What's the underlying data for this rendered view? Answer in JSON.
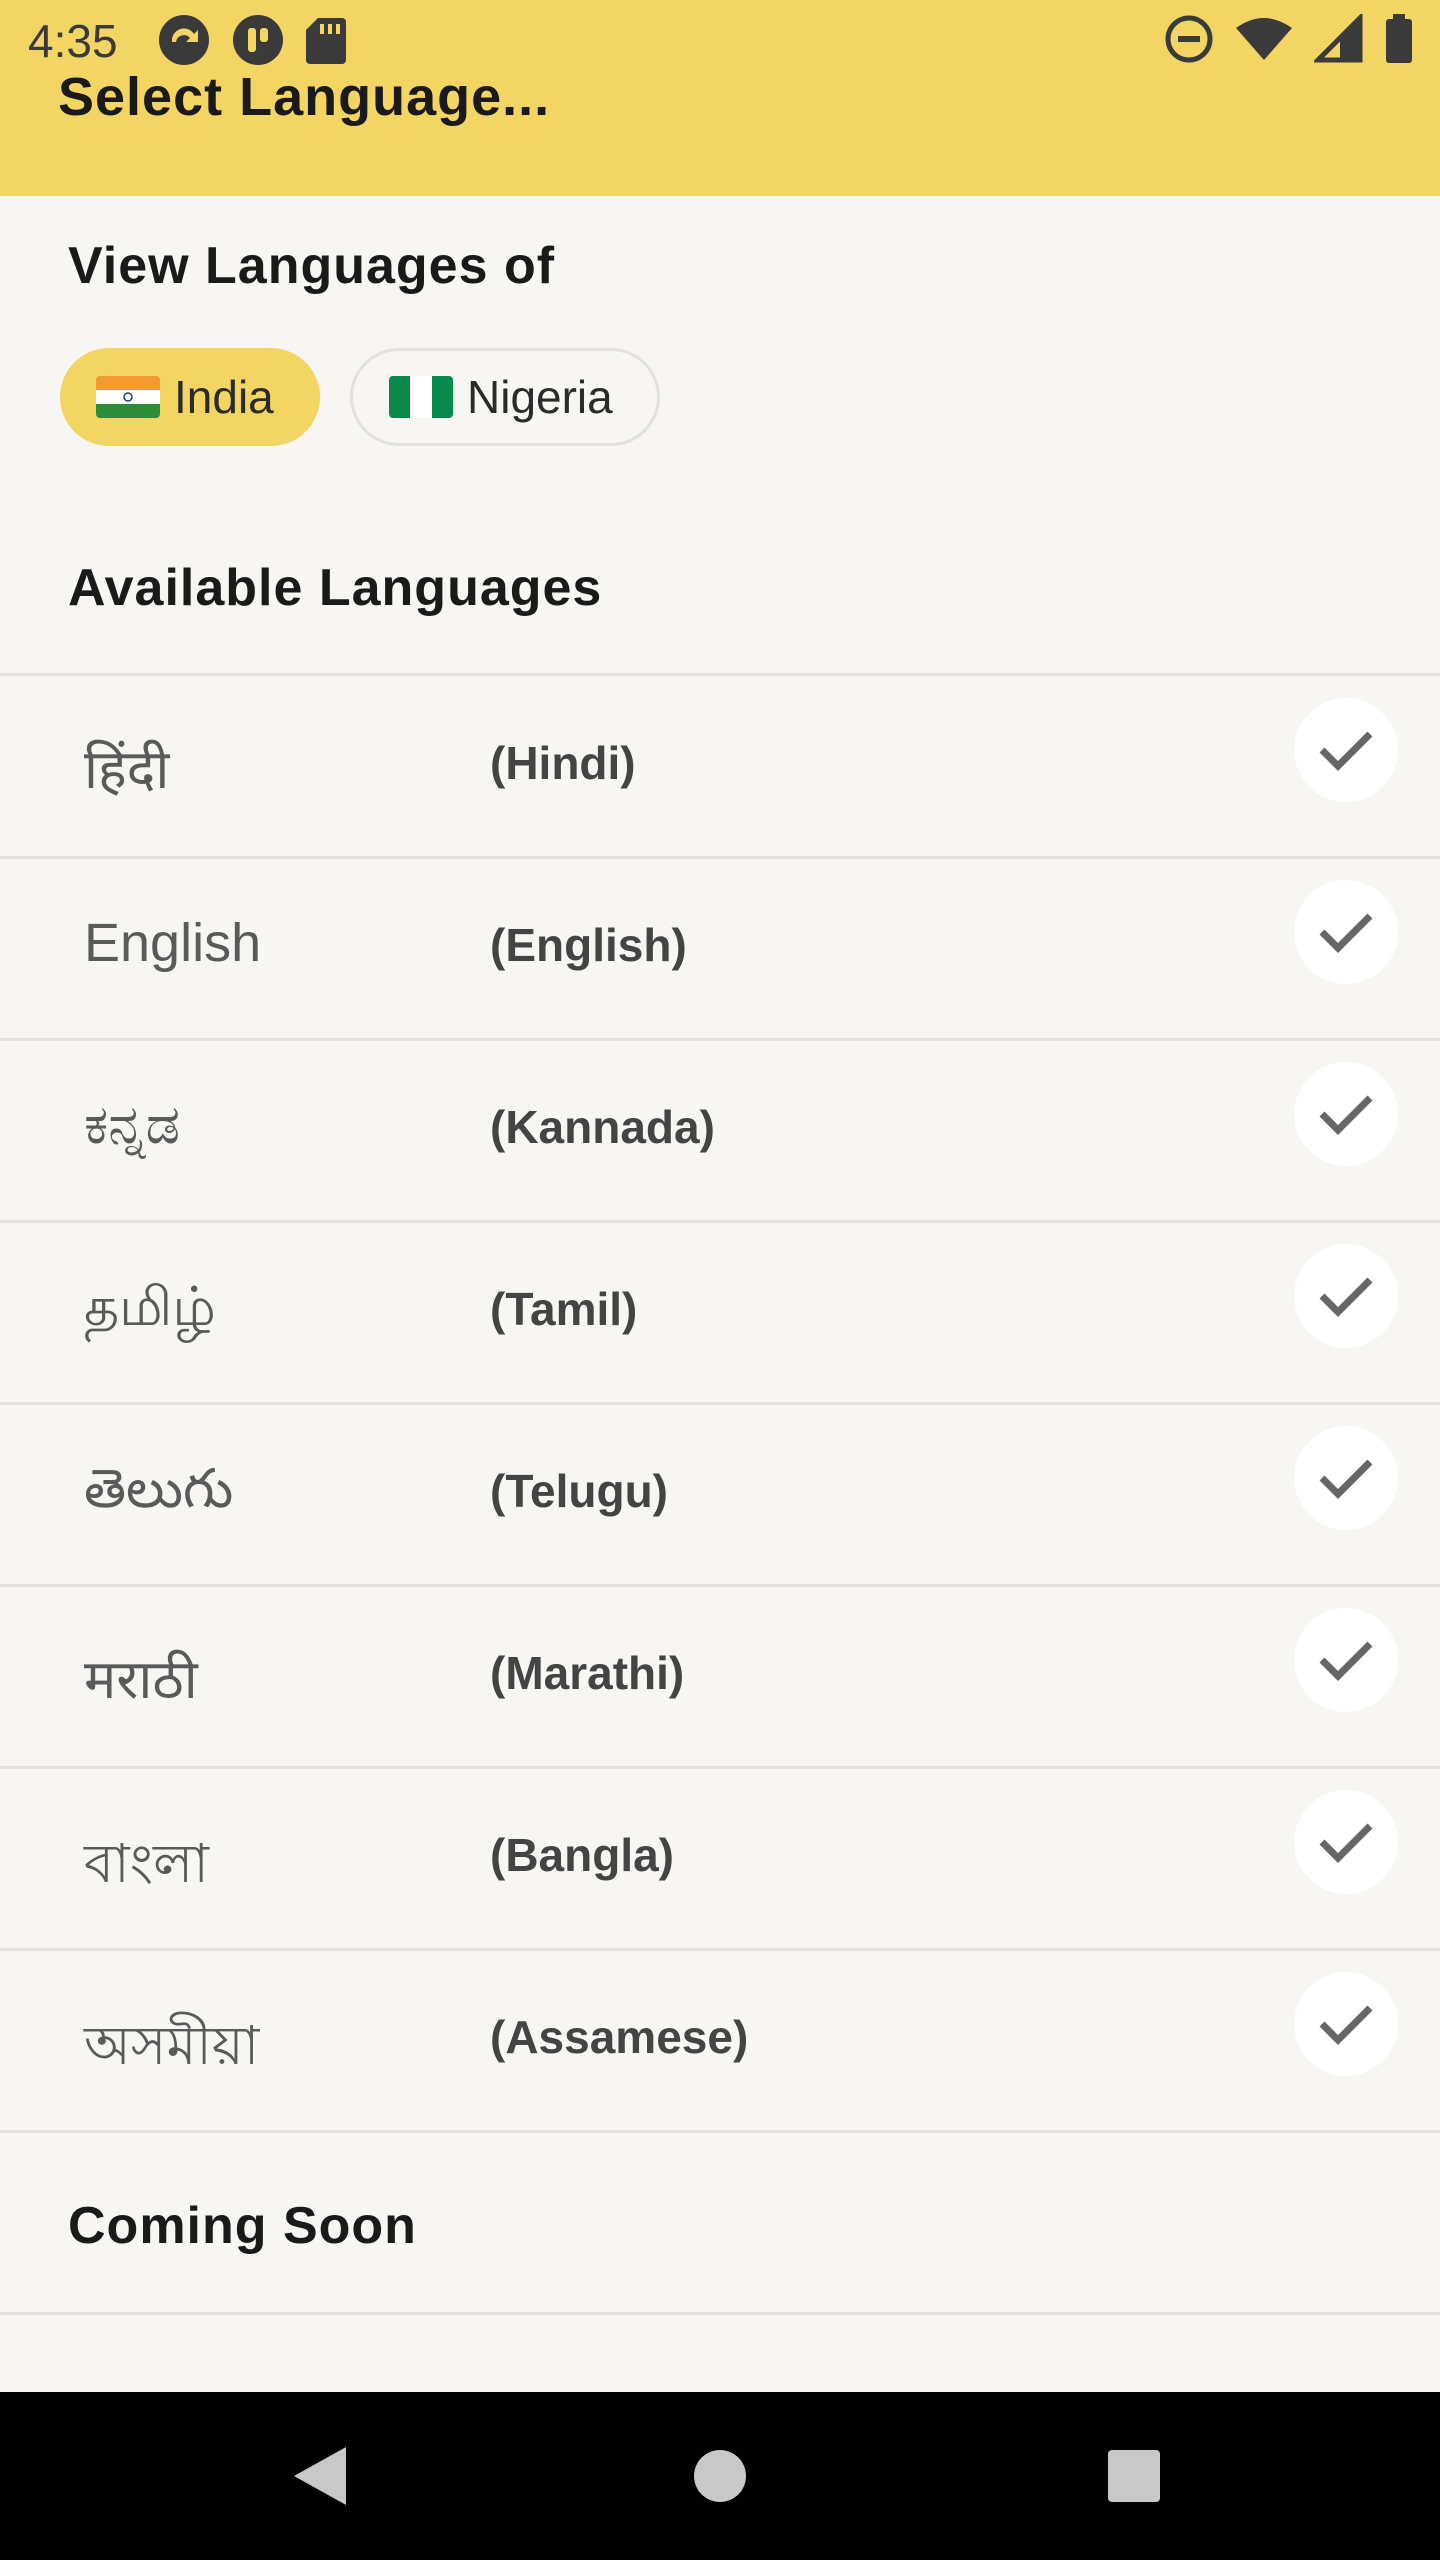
{
  "status_bar": {
    "time": "4:35",
    "left_icons": [
      "sync-icon",
      "app-icon",
      "sd-card-icon"
    ],
    "right_icons": [
      "do-not-disturb-icon",
      "wifi-icon",
      "signal-icon",
      "battery-icon"
    ]
  },
  "app_bar": {
    "title": "Select Language...",
    "color": "#f2d562"
  },
  "view_languages": {
    "title": "View Languages of",
    "chips": [
      {
        "label": "India",
        "flag": "india-flag-icon",
        "selected": true
      },
      {
        "label": "Nigeria",
        "flag": "nigeria-flag-icon",
        "selected": false
      }
    ]
  },
  "available": {
    "title": "Available Languages",
    "languages": [
      {
        "native": "हिंदी",
        "english": "(Hindi)"
      },
      {
        "native": "English",
        "english": "(English)"
      },
      {
        "native": "ಕನ್ನಡ",
        "english": "(Kannada)"
      },
      {
        "native": "தமிழ்",
        "english": "(Tamil)"
      },
      {
        "native": "తెలుగు",
        "english": "(Telugu)"
      },
      {
        "native": "मराठी",
        "english": "(Marathi)"
      },
      {
        "native": "বাংলা",
        "english": "(Bangla)"
      },
      {
        "native": "অসমীয়া",
        "english": "(Assamese)"
      }
    ]
  },
  "coming_soon": {
    "title": "Coming Soon"
  },
  "nav_bar": {
    "buttons": [
      "back-icon",
      "home-icon",
      "recents-icon"
    ]
  }
}
